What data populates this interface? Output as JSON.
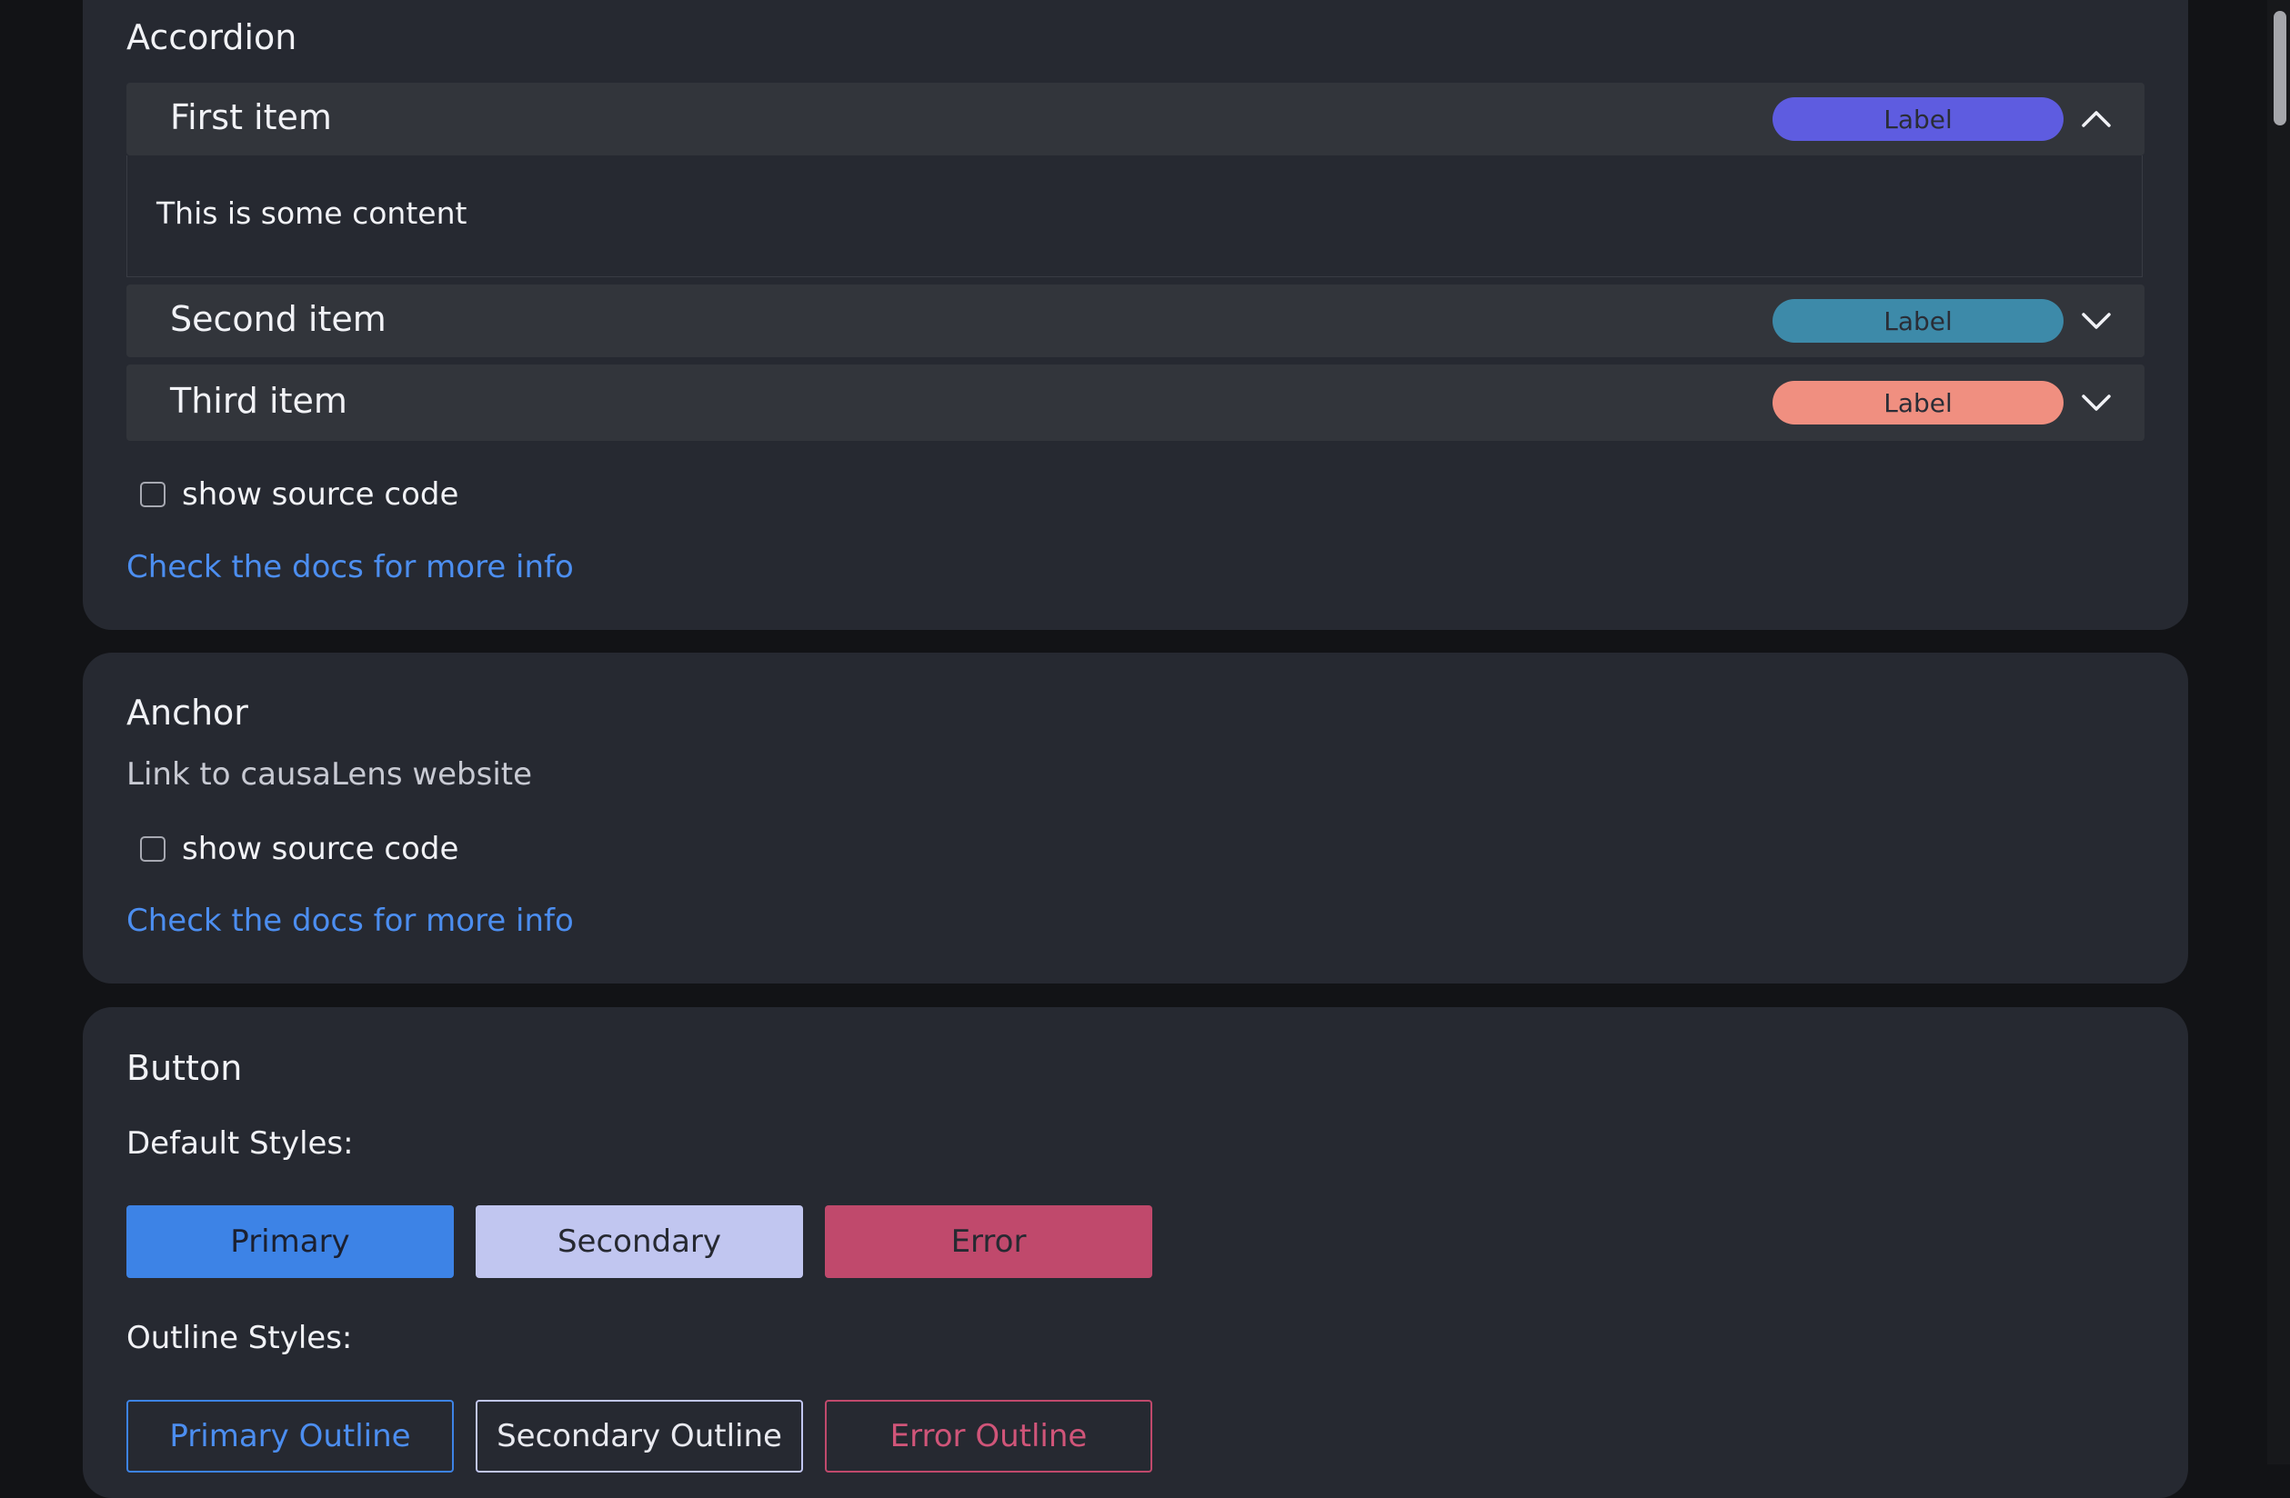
{
  "accordion": {
    "title": "Accordion",
    "items": [
      {
        "label": "First item",
        "badge": "Label",
        "badge_color": "#5e5ce0",
        "expanded": true,
        "content": "This is some content"
      },
      {
        "label": "Second item",
        "badge": "Label",
        "badge_color": "#3d8aa9",
        "expanded": false
      },
      {
        "label": "Third item",
        "badge": "Label",
        "badge_color": "#f08f80",
        "expanded": false
      }
    ],
    "show_source": "show source code",
    "docs_link": "Check the docs for more info"
  },
  "anchor": {
    "title": "Anchor",
    "link_text": "Link to causaLens website",
    "show_source": "show source code",
    "docs_link": "Check the docs for more info"
  },
  "button": {
    "title": "Button",
    "default_heading": "Default Styles:",
    "default_buttons": [
      "Primary",
      "Secondary",
      "Error"
    ],
    "outline_heading": "Outline Styles:",
    "outline_buttons": [
      "Primary Outline",
      "Secondary Outline",
      "Error Outline"
    ]
  },
  "colors": {
    "page_bg": "#121316",
    "card_bg": "#262931",
    "accordion_header_bg": "#32353b",
    "link": "#4c8ef0",
    "primary": "#3d83e6",
    "secondary": "#c1c6f0",
    "error": "#c0496c"
  }
}
